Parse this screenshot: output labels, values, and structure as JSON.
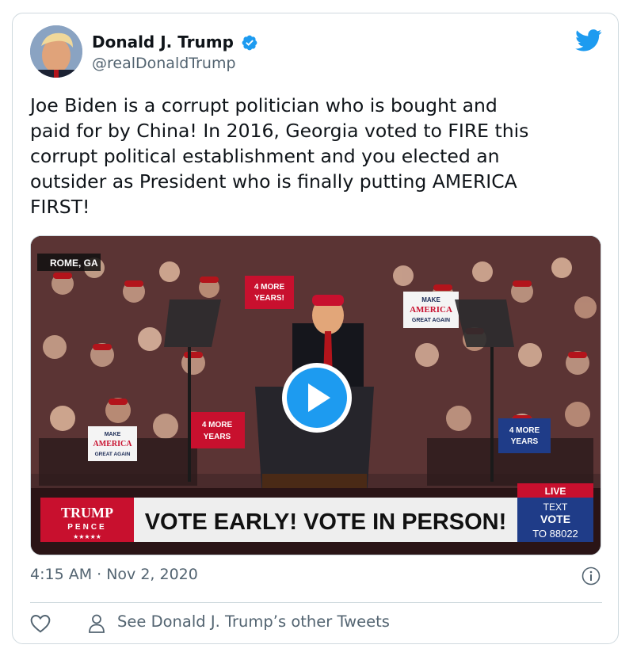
{
  "author": {
    "name": "Donald J. Trump",
    "handle": "@realDonaldTrump",
    "verified": true
  },
  "tweet": {
    "text": "Joe Biden is a corrupt politician who is bought and\npaid for by China! In 2016, Georgia voted to FIRE this\ncorrupt political establishment and you elected an\noutsider as President who is finally putting AMERICA\nFIRST!",
    "timestamp": "4:15 AM · Nov 2, 2020"
  },
  "video": {
    "location_tag": "ROME, GA",
    "banner_brand_top": "TRUMP",
    "banner_brand_bottom": "PENCE",
    "banner_stars": "★★★★★",
    "banner_headline": "VOTE EARLY! VOTE IN PERSON!",
    "live_label": "LIVE",
    "text_line1": "TEXT",
    "text_line2": "VOTE",
    "text_line3": "TO 88022",
    "signs": {
      "four_more_years_a": "4 MORE",
      "four_more_years_b": "YEARS!",
      "maga_a": "MAKE",
      "maga_b": "AMERICA",
      "maga_c": "GREAT AGAIN",
      "four_more_small_a": "4 MORE",
      "four_more_small_b": "YEARS"
    }
  },
  "footer": {
    "see_others": "See Donald J. Trump’s other Tweets"
  },
  "icons": {
    "twitter_bird": "twitter-bird-icon",
    "verified": "verified-badge-icon",
    "play": "play-icon",
    "info": "info-icon",
    "like": "heart-icon",
    "profile": "person-icon"
  },
  "colors": {
    "twitter_blue": "#1d9bf0",
    "secondary_text": "#536471",
    "trump_red": "#c8102e"
  }
}
